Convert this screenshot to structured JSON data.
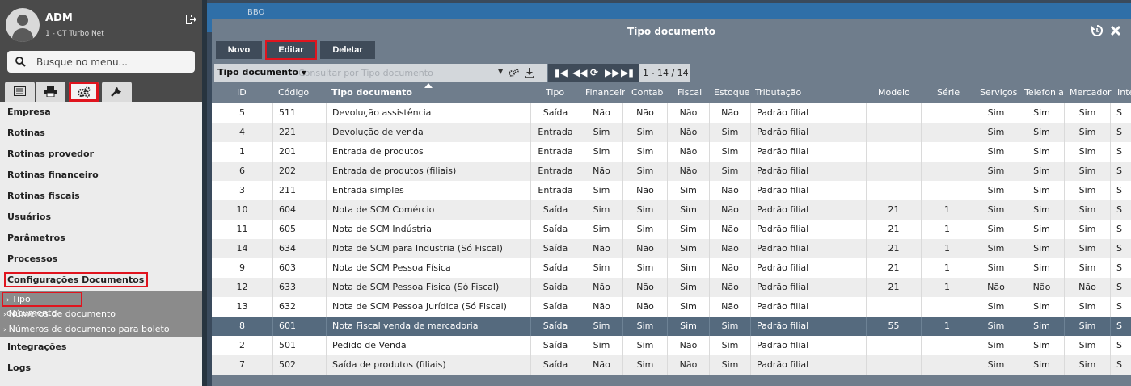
{
  "user": {
    "name": "ADM",
    "company": "1 - CT Turbo Net"
  },
  "search": {
    "placeholder": "Busque no menu..."
  },
  "sidebar_tabs": [
    "list-icon",
    "printer-icon",
    "gears-icon",
    "wrench-icon"
  ],
  "menu": [
    "Empresa",
    "Rotinas",
    "Rotinas provedor",
    "Rotinas financeiro",
    "Rotinas fiscais",
    "Usuários",
    "Parâmetros",
    "Processos",
    "Configurações Documentos"
  ],
  "submenu": [
    "Tipo documento",
    "Números de documento",
    "Números de documento para boleto"
  ],
  "menu_after": [
    "Integrações",
    "Logs"
  ],
  "bg": {
    "title": "BBO"
  },
  "dialog": {
    "title": "Tipo documento",
    "buttons": {
      "new": "Novo",
      "edit": "Editar",
      "delete": "Deletar"
    },
    "filter": {
      "field": "Tipo documento",
      "placeholder": "Consultar por Tipo documento"
    },
    "pager": {
      "count": "1 - 14 / 14"
    }
  },
  "grid": {
    "columns": [
      "ID",
      "Código",
      "Tipo documento",
      "Tipo",
      "Financeirc",
      "Contab",
      "Fiscal",
      "Estoque",
      "Tributação",
      "Modelo",
      "Série",
      "Serviços",
      "Telefonia",
      "Mercador",
      "Inte"
    ],
    "rows": [
      [
        "5",
        "511",
        "Devolução assistência",
        "Saída",
        "Não",
        "Não",
        "Não",
        "Não",
        "Padrão filial",
        "",
        "",
        "Sim",
        "Sim",
        "Sim",
        "S"
      ],
      [
        "4",
        "221",
        "Devolução de venda",
        "Entrada",
        "Sim",
        "Sim",
        "Não",
        "Sim",
        "Padrão filial",
        "",
        "",
        "Sim",
        "Sim",
        "Sim",
        "S"
      ],
      [
        "1",
        "201",
        "Entrada de produtos",
        "Entrada",
        "Sim",
        "Sim",
        "Não",
        "Sim",
        "Padrão filial",
        "",
        "",
        "Sim",
        "Sim",
        "Sim",
        "S"
      ],
      [
        "6",
        "202",
        "Entrada de produtos (filiais)",
        "Entrada",
        "Não",
        "Sim",
        "Não",
        "Sim",
        "Padrão filial",
        "",
        "",
        "Sim",
        "Sim",
        "Sim",
        "S"
      ],
      [
        "3",
        "211",
        "Entrada simples",
        "Entrada",
        "Sim",
        "Não",
        "Sim",
        "Não",
        "Padrão filial",
        "",
        "",
        "Sim",
        "Sim",
        "Sim",
        "S"
      ],
      [
        "10",
        "604",
        "Nota de SCM Comércio",
        "Saída",
        "Sim",
        "Sim",
        "Sim",
        "Não",
        "Padrão filial",
        "21",
        "1",
        "Sim",
        "Sim",
        "Sim",
        "S"
      ],
      [
        "11",
        "605",
        "Nota de SCM Indústria",
        "Saída",
        "Sim",
        "Sim",
        "Sim",
        "Não",
        "Padrão filial",
        "21",
        "1",
        "Sim",
        "Sim",
        "Sim",
        "S"
      ],
      [
        "14",
        "634",
        "Nota de SCM para Industria (Só Fiscal)",
        "Saída",
        "Não",
        "Não",
        "Sim",
        "Não",
        "Padrão filial",
        "21",
        "1",
        "Sim",
        "Sim",
        "Sim",
        "S"
      ],
      [
        "9",
        "603",
        "Nota de SCM Pessoa Física",
        "Saída",
        "Sim",
        "Sim",
        "Sim",
        "Não",
        "Padrão filial",
        "21",
        "1",
        "Sim",
        "Sim",
        "Sim",
        "S"
      ],
      [
        "12",
        "633",
        "Nota de SCM Pessoa Física (Só Fiscal)",
        "Saída",
        "Não",
        "Não",
        "Sim",
        "Não",
        "Padrão filial",
        "21",
        "1",
        "Não",
        "Não",
        "Não",
        "S"
      ],
      [
        "13",
        "632",
        "Nota de SCM Pessoa Jurídica (Só Fiscal)",
        "Saída",
        "Não",
        "Não",
        "Sim",
        "Não",
        "Padrão filial",
        "",
        "",
        "Sim",
        "Sim",
        "Sim",
        "S"
      ],
      [
        "8",
        "601",
        "Nota Fiscal venda de mercadoria",
        "Saída",
        "Sim",
        "Sim",
        "Sim",
        "Sim",
        "Padrão filial",
        "55",
        "1",
        "Sim",
        "Sim",
        "Sim",
        "S"
      ],
      [
        "2",
        "501",
        "Pedido de Venda",
        "Saída",
        "Sim",
        "Sim",
        "Não",
        "Sim",
        "Padrão filial",
        "",
        "",
        "Sim",
        "Sim",
        "Sim",
        "S"
      ],
      [
        "7",
        "502",
        "Saída de produtos (filiais)",
        "Saída",
        "Não",
        "Sim",
        "Não",
        "Sim",
        "Padrão filial",
        "",
        "",
        "Sim",
        "Sim",
        "Sim",
        "S"
      ]
    ],
    "selected_row": 11
  },
  "colors": {
    "accent_red": "#e0141e",
    "dialog_bg": "#6f7d8c",
    "selected_row": "#556a7e",
    "sidebar_dark": "#4a4a4a"
  }
}
